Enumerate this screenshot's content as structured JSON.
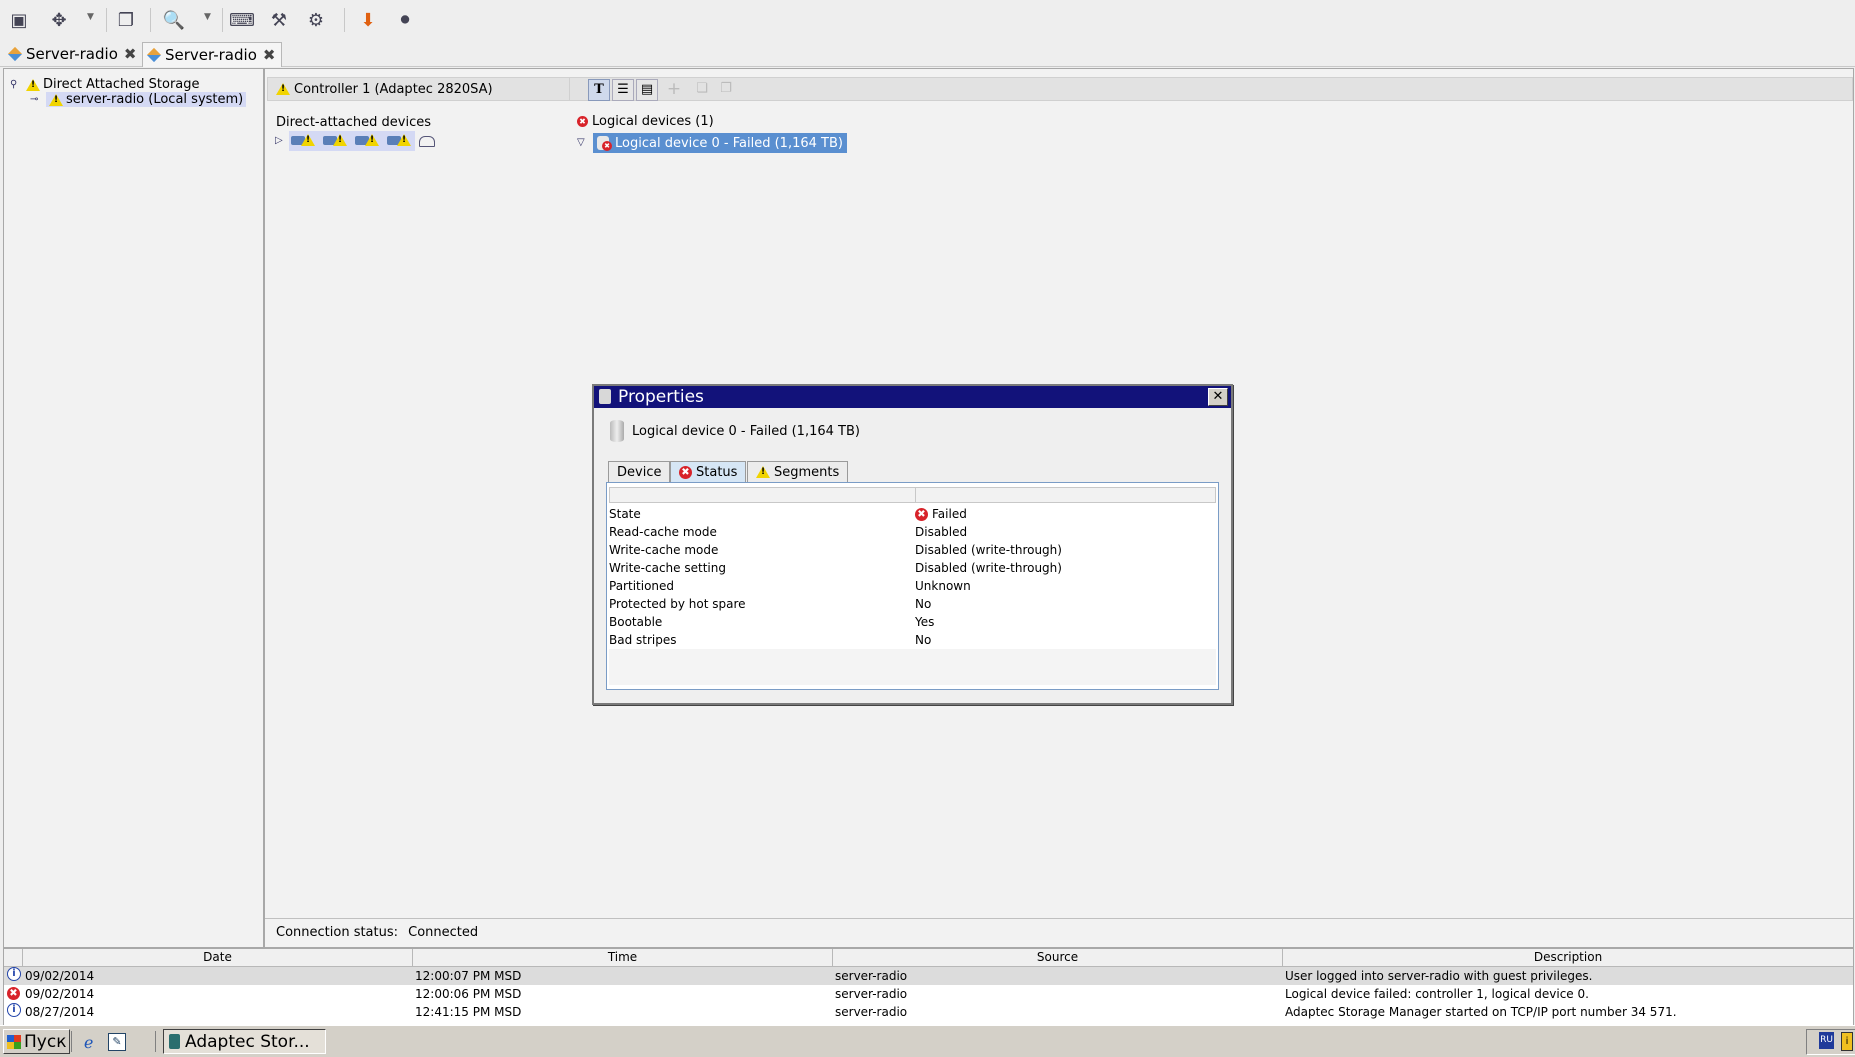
{
  "toolbar": {
    "icons": [
      "window-icon",
      "resize-icon",
      "dropdown-arrow-icon",
      "windows-icon",
      "zoom-icon",
      "dropdown-arrow-icon",
      "keyboard-icon",
      "tools-icon",
      "gears-icon",
      "download-icon",
      "plug-icon"
    ]
  },
  "tabs": [
    {
      "label": "Server-radio",
      "active": false
    },
    {
      "label": "Server-radio",
      "active": true
    }
  ],
  "left": {
    "tree": [
      {
        "label": "Direct Attached Storage",
        "level": 0
      },
      {
        "label": "server-radio (Local system)",
        "level": 1,
        "selected": true
      }
    ]
  },
  "physical": {
    "controller": "Controller 1 (Adaptec 2820SA)",
    "devices_label": "Direct-attached devices"
  },
  "logical": {
    "header": "Logical devices (1)",
    "device": "Logical device 0 - Failed (1,164 TB)"
  },
  "connection": {
    "label": "Connection status:",
    "value": "Connected"
  },
  "dialog": {
    "title": "Properties",
    "device_name": "Logical device 0 - Failed (1,164 TB)",
    "tabs": [
      "Device",
      "Status",
      "Segments"
    ],
    "active_tab": "Status",
    "rows": [
      {
        "key": "State",
        "value": "Failed"
      },
      {
        "key": "Read-cache mode",
        "value": "Disabled"
      },
      {
        "key": "Write-cache mode",
        "value": "Disabled (write-through)"
      },
      {
        "key": "Write-cache setting",
        "value": "Disabled (write-through)"
      },
      {
        "key": "Partitioned",
        "value": "Unknown"
      },
      {
        "key": "Protected by hot spare",
        "value": "No"
      },
      {
        "key": "Bootable",
        "value": "Yes"
      },
      {
        "key": "Bad stripes",
        "value": "No"
      }
    ]
  },
  "log": {
    "headers": [
      "Date",
      "Time",
      "Source",
      "Description"
    ],
    "rows": [
      {
        "type": "info",
        "date": "09/02/2014",
        "time": "12:00:07 PM MSD",
        "source": "server-radio",
        "description": "User logged into server-radio with guest privileges."
      },
      {
        "type": "error",
        "date": "09/02/2014",
        "time": "12:00:06 PM MSD",
        "source": "server-radio",
        "description": "Logical device failed: controller 1, logical device 0."
      },
      {
        "type": "info",
        "date": "08/27/2014",
        "time": "12:41:15 PM MSD",
        "source": "server-radio",
        "description": "Adaptec Storage Manager started on TCP/IP port number 34 571."
      }
    ]
  },
  "taskbar": {
    "start_label": "Пуск",
    "window_label": "Adaptec Stor...",
    "lang": "RU"
  },
  "colors": {
    "dialog_title": "#12127a",
    "selection": "#5a8fd0",
    "error": "#d8232a",
    "warning": "#f1d400"
  }
}
